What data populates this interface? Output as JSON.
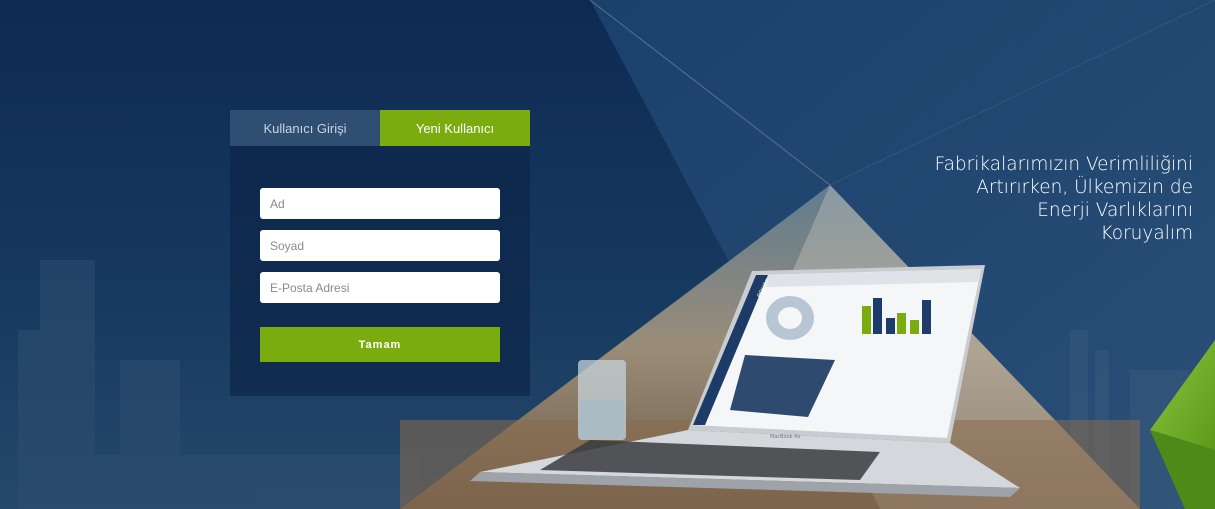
{
  "tabs": {
    "login_label": "Kullanıcı Girişi",
    "register_label": "Yeni Kullanıcı",
    "active": "register"
  },
  "form": {
    "first_name": {
      "placeholder": "Ad",
      "value": ""
    },
    "last_name": {
      "placeholder": "Soyad",
      "value": ""
    },
    "email": {
      "placeholder": "E-Posta Adresi",
      "value": ""
    },
    "submit_label": "Tamam"
  },
  "slogan": {
    "line1": "Fabrikalarımızın Verimliliğini",
    "line2": "Artırırken, Ülkemizin de",
    "line3": "Enerji Varlıklarını",
    "line4": "Koruyalım"
  },
  "laptop": {
    "brand": "MacBook Air",
    "app_logo": "enver"
  },
  "colors": {
    "navy": "#0f2c52",
    "accent_green": "#7aac0f",
    "inactive_tab": "#2f4f72"
  }
}
